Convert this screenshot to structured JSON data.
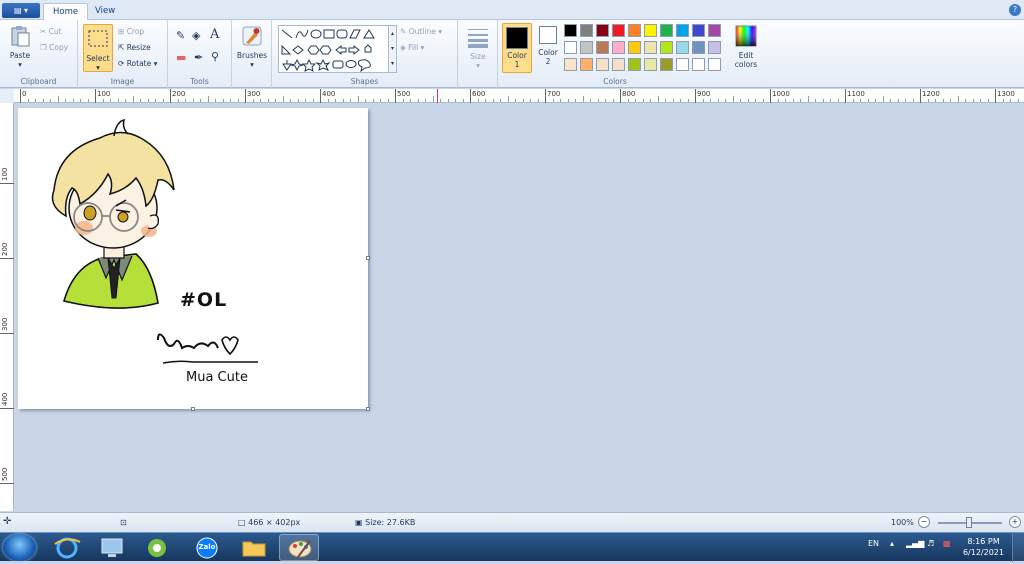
{
  "tabs": {
    "home": "Home",
    "view": "View"
  },
  "clipboard": {
    "label": "Clipboard",
    "paste": "Paste",
    "cut": "Cut",
    "copy": "Copy"
  },
  "image": {
    "label": "Image",
    "select": "Select",
    "crop": "Crop",
    "resize": "Resize",
    "rotate": "Rotate"
  },
  "tools": {
    "label": "Tools"
  },
  "brushes": {
    "label": "Brushes"
  },
  "shapes": {
    "label": "Shapes",
    "outline": "Outline",
    "fill": "Fill"
  },
  "size": {
    "label": "Size"
  },
  "colors": {
    "label": "Colors",
    "color1": "Color",
    "color1_num": "1",
    "color2": "Color",
    "color2_num": "2",
    "edit": "Edit",
    "edit2": "colors",
    "color1_value": "#000000",
    "color2_value": "#ffffff",
    "palette_row1": [
      "#000000",
      "#7f7f7f",
      "#880015",
      "#ed1c24",
      "#ff7f27",
      "#fff200",
      "#22b14c",
      "#00a2e8",
      "#3f48cc",
      "#a349a4"
    ],
    "palette_row2": [
      "#ffffff",
      "#c3c3c3",
      "#b97a57",
      "#ffaec9",
      "#ffc90e",
      "#efe4b0",
      "#b5e61d",
      "#99d9ea",
      "#7092be",
      "#c8bfe7"
    ],
    "palette_row3": [
      "#fbe3c9",
      "#ffb06b",
      "#f4e2c8",
      "#f3e0c8",
      "#a3c11c",
      "#e7e7a8",
      "#9b9b2b",
      "#ffffff",
      "#ffffff",
      "#ffffff"
    ]
  },
  "ruler_h": [
    "0",
    "100",
    "200",
    "300",
    "400",
    "500",
    "600",
    "700",
    "800",
    "900",
    "1000",
    "1100",
    "1200",
    "1300"
  ],
  "ruler_v": [
    "100",
    "200",
    "300",
    "400",
    "500"
  ],
  "artwork": {
    "hashtag": "#OL",
    "signature": "Mua Cute"
  },
  "status": {
    "dimensions": "466 × 402px",
    "size": "Size: 27.6KB",
    "zoom": "100%"
  },
  "taskbar": {
    "lang": "EN",
    "time": "8:16 PM",
    "date": "6/12/2021",
    "zalo": "Zalo"
  }
}
